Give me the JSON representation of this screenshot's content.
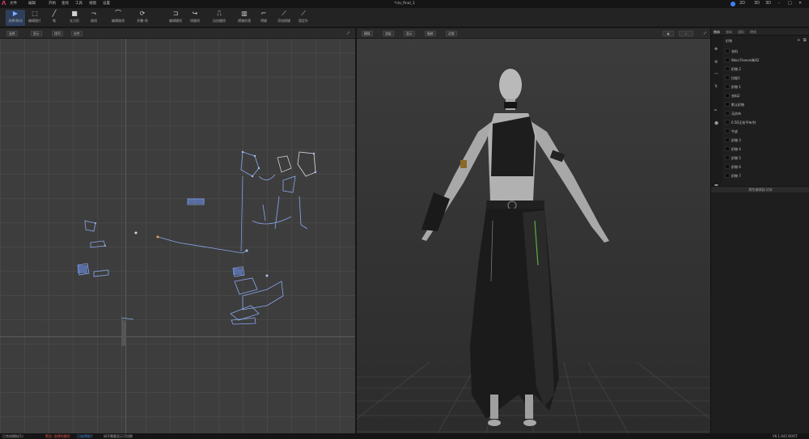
{
  "titlebar": {
    "menus": [
      "文件",
      "编辑",
      "开始",
      "查找",
      "工具",
      "视图",
      "设置"
    ],
    "window_title": "*clo_final_1",
    "right_text": [
      "2D",
      "3D",
      "3D"
    ]
  },
  "toolbar": {
    "tools": [
      {
        "label": "选择/移动",
        "icon": "select-arrow-icon"
      },
      {
        "label": "编辑图片",
        "icon": "edit-rect-icon"
      },
      {
        "label": "笔",
        "icon": "pen-icon"
      },
      {
        "label": "长方形",
        "icon": "rectangle-icon"
      },
      {
        "label": "曲线",
        "icon": "curve-icon"
      },
      {
        "label": "编辑曲线",
        "icon": "edit-curve-icon"
      },
      {
        "label": "折叠-线",
        "icon": "fold-line-icon"
      },
      {
        "label": "编辑缝纫",
        "icon": "edit-sewing-icon"
      },
      {
        "label": "线缝纫",
        "icon": "line-sewing-icon"
      },
      {
        "label": "自由缝纫",
        "icon": "free-sewing-icon"
      },
      {
        "label": "褶皱处理",
        "icon": "pleat-icon"
      },
      {
        "label": "明缝",
        "icon": "topstitch-icon"
      },
      {
        "label": "添加假缝",
        "icon": "baste-icon"
      },
      {
        "label": "固定针",
        "icon": "pin-icon"
      }
    ]
  },
  "pane_2d": {
    "chips": [
      "选择",
      "显示",
      "排列",
      "对齐"
    ]
  },
  "pane_3d": {
    "chips": [
      "模拟",
      "渲染",
      "显示",
      "服装",
      "试穿"
    ]
  },
  "side": {
    "tabs": [
      "物体",
      "衣料",
      "纽扣",
      "明线"
    ],
    "object_header": "织物",
    "objects": [
      "衣料",
      "Wool Fleece/新62",
      "织物 2",
      "拉链3",
      "织物 1",
      "衣料2",
      "默认织物",
      "无纺布",
      "0.5D正纺平布/针",
      "牛皮",
      "织物 3",
      "织物 4",
      "织物 5",
      "织物 6",
      "织物 7"
    ],
    "props_header": "属性编辑器/试穿"
  },
  "status": {
    "left": "已完成模拟(1)",
    "warn": "警告: 选择的操作",
    "link": "已选择版片",
    "info": "如不需要显示可切换",
    "version": "V6.1.642 BOOT"
  },
  "colors": {
    "pattern_line": "#6a8fe6",
    "accent": "#3b82f6",
    "logo": "#e03a7a"
  }
}
